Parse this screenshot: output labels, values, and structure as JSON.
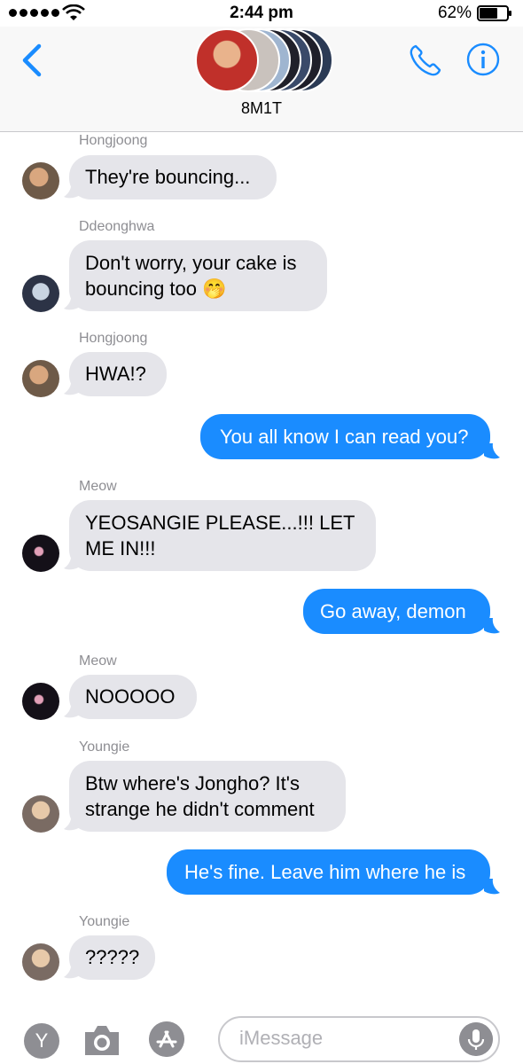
{
  "status": {
    "time": "2:44 pm",
    "battery": "62%"
  },
  "header": {
    "group_name": "8M1T"
  },
  "messages": [
    {
      "type": "in",
      "sender": "Hongjoong",
      "lines": [
        "They're bouncing..."
      ]
    },
    {
      "type": "in",
      "sender": "Ddeonghwa",
      "lines": [
        "Don't worry, your cake is",
        "bouncing too 🤭"
      ]
    },
    {
      "type": "in",
      "sender": "Hongjoong",
      "lines": [
        "HWA!?"
      ]
    },
    {
      "type": "out",
      "lines": [
        "You all know I can read you?"
      ]
    },
    {
      "type": "in",
      "sender": "Meow",
      "lines": [
        "YEOSANGIE PLEASE...!!! LET",
        "ME IN!!!"
      ]
    },
    {
      "type": "out",
      "lines": [
        "Go away, demon"
      ]
    },
    {
      "type": "in",
      "sender": "Meow",
      "lines": [
        "NOOOOO"
      ]
    },
    {
      "type": "in",
      "sender": "Youngie",
      "lines": [
        "Btw where's Jongho? It's",
        "strange he didn't comment"
      ]
    },
    {
      "type": "out",
      "lines": [
        "He's fine. Leave him where he is"
      ]
    },
    {
      "type": "in",
      "sender": "Youngie",
      "lines": [
        "?????"
      ]
    }
  ],
  "bottom": {
    "apps_label": "Y",
    "input_placeholder": "iMessage"
  },
  "colors": {
    "accent": "#1a8cff",
    "bubble_in": "#e5e5ea",
    "sender": "#8e8e93"
  }
}
